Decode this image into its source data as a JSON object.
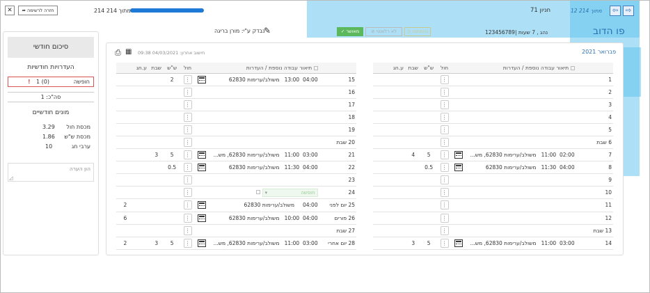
{
  "top": {
    "back_label": "חזרה לרשימה",
    "progress_text": "214 מתוך 214",
    "progress_fraction": 1.0,
    "title_center": "71 חניון",
    "page_counter": "12 מתוך 214",
    "close_glyph": "✕",
    "back_glyph": "➦",
    "prev_glyph": "⇦",
    "next_glyph": "⇨"
  },
  "employee": {
    "name": "פו הדוב",
    "details": "123456789| נהג , 7 שעות",
    "checked_by": "נבדק ע\"י: מורן בריגה",
    "approve_label": "מאושר",
    "not_relevant_label": "לא רלוונטי",
    "pending_label": "בהמתנה"
  },
  "left_month": {
    "title": "פברואר 2021",
    "headers": [
      "תיאור עבודה נוספת / העדרות",
      "חול",
      "ש\"ש",
      "שבת",
      "ע.חג"
    ],
    "rows": [
      {
        "day": "1",
        "label": "",
        "desc": "",
        "calc": false,
        "hol": "",
        "ss": "",
        "shabat": "",
        "hag": ""
      },
      {
        "day": "2",
        "label": "",
        "desc": "",
        "calc": false,
        "hol": "",
        "ss": "",
        "shabat": "",
        "hag": ""
      },
      {
        "day": "3",
        "label": "",
        "desc": "",
        "calc": false,
        "hol": "",
        "ss": "",
        "shabat": "",
        "hag": ""
      },
      {
        "day": "4",
        "label": "",
        "desc": "",
        "calc": false,
        "hol": "",
        "ss": "",
        "shabat": "",
        "hag": ""
      },
      {
        "day": "5",
        "label": "",
        "desc": "",
        "calc": false,
        "hol": "",
        "ss": "",
        "shabat": "",
        "hag": ""
      },
      {
        "day": "6",
        "label": "שבת",
        "desc": "",
        "calc": false,
        "hol": "",
        "ss": "",
        "shabat": "",
        "hag": ""
      },
      {
        "day": "7",
        "label": "",
        "start": "02:00",
        "end": "11:00",
        "desc": "משולב/ערימות 62830, מש...",
        "calc": true,
        "hol": "5",
        "ss": "4",
        "shabat": "",
        "hag": ""
      },
      {
        "day": "8",
        "label": "",
        "start": "04:00",
        "end": "11:30",
        "desc": "משולב/ערימות 62830",
        "calc": true,
        "hol": "0.5",
        "ss": "",
        "shabat": "",
        "hag": ""
      },
      {
        "day": "9",
        "label": "",
        "desc": "",
        "calc": false,
        "hol": "",
        "ss": "",
        "shabat": "",
        "hag": ""
      },
      {
        "day": "10",
        "label": "",
        "desc": "",
        "calc": false,
        "hol": "",
        "ss": "",
        "shabat": "",
        "hag": ""
      },
      {
        "day": "11",
        "label": "",
        "desc": "",
        "calc": false,
        "hol": "",
        "ss": "",
        "shabat": "",
        "hag": ""
      },
      {
        "day": "12",
        "label": "",
        "desc": "",
        "calc": false,
        "hol": "",
        "ss": "",
        "shabat": "",
        "hag": ""
      },
      {
        "day": "13",
        "label": "שבת",
        "desc": "",
        "calc": false,
        "hol": "",
        "ss": "",
        "shabat": "",
        "hag": ""
      },
      {
        "day": "14",
        "label": "",
        "start": "03:00",
        "end": "11:00",
        "desc": "משולב/ערימות 62830, מש...",
        "calc": true,
        "hol": "5",
        "ss": "3",
        "shabat": "",
        "hag": ""
      }
    ]
  },
  "right_month": {
    "last_calc": "חישוב אחרון: 04/03/2021 09:38",
    "headers": [
      "תיאור עבודה נוספת / העדרות",
      "חול",
      "ש\"ש",
      "שבת",
      "ע.חג"
    ],
    "rows": [
      {
        "day": "15",
        "label": "",
        "start": "04:00",
        "end": "13:00",
        "desc": "משולב/ערימות 62830",
        "calc": true,
        "hol": "2",
        "ss": "",
        "shabat": "",
        "hag": ""
      },
      {
        "day": "16",
        "label": "",
        "desc": "",
        "calc": false,
        "hol": "",
        "ss": "",
        "shabat": "",
        "hag": ""
      },
      {
        "day": "17",
        "label": "",
        "desc": "",
        "calc": false,
        "hol": "",
        "ss": "",
        "shabat": "",
        "hag": ""
      },
      {
        "day": "18",
        "label": "",
        "desc": "",
        "calc": false,
        "hol": "",
        "ss": "",
        "shabat": "",
        "hag": ""
      },
      {
        "day": "19",
        "label": "",
        "desc": "",
        "calc": false,
        "hol": "",
        "ss": "",
        "shabat": "",
        "hag": ""
      },
      {
        "day": "20",
        "label": "שבת",
        "desc": "",
        "calc": false,
        "hol": "",
        "ss": "",
        "shabat": "",
        "hag": ""
      },
      {
        "day": "21",
        "label": "",
        "start": "03:00",
        "end": "11:00",
        "desc": "משולב/ערימות 62830, מש...",
        "calc": true,
        "hol": "5",
        "ss": "3",
        "shabat": "",
        "hag": ""
      },
      {
        "day": "22",
        "label": "",
        "start": "04:00",
        "end": "11:30",
        "desc": "משולב/ערימות 62830",
        "calc": true,
        "hol": "0.5",
        "ss": "",
        "shabat": "",
        "hag": ""
      },
      {
        "day": "23",
        "label": "",
        "desc": "",
        "calc": false,
        "hol": "",
        "ss": "",
        "shabat": "",
        "hag": ""
      },
      {
        "day": "24",
        "label": "",
        "dropdown": "חופשה",
        "desc": "",
        "calc": false,
        "hol": "",
        "ss": "",
        "shabat": "",
        "hag": ""
      },
      {
        "day": "25",
        "label": "יום לפני",
        "start": "04:00",
        "end": "",
        "desc": "משולב/ערימות 62830",
        "calc": true,
        "hol": "",
        "ss": "",
        "shabat": "",
        "hag": "2"
      },
      {
        "day": "26",
        "label": "פורים",
        "start": "04:00",
        "end": "10:00",
        "desc": "משולב/ערימות 62830",
        "calc": true,
        "hol": "",
        "ss": "",
        "shabat": "",
        "hag": "6"
      },
      {
        "day": "27",
        "label": "שבת",
        "desc": "",
        "calc": false,
        "hol": "",
        "ss": "",
        "shabat": "",
        "hag": ""
      },
      {
        "day": "28",
        "label": "יום אחרי",
        "start": "03:00",
        "end": "11:00",
        "desc": "משולב/ערימות 62830, מש...",
        "calc": true,
        "hol": "5",
        "ss": "3",
        "shabat": "",
        "hag": "2"
      }
    ]
  },
  "summary": {
    "title": "סיכום חודשי",
    "absences_title": "העדרויות חודשיות",
    "vacation_label": "חופשה",
    "vacation_value": "1 (0)",
    "alert_glyph": "!",
    "total": "סה\"כ: 1",
    "counters_title": "מונים חודשיים",
    "counters": [
      {
        "label": "מכסת חול",
        "value": "3.29"
      },
      {
        "label": "מכסת ש\"ש",
        "value": "1.86"
      },
      {
        "label": "ערבי חג",
        "value": "10"
      }
    ],
    "note_placeholder": "הון הערה"
  },
  "colors": {
    "accent": "#2a6fb0",
    "highlight": "#5bc2ee",
    "approve": "#5cb85c",
    "alert": "#d9534f"
  }
}
